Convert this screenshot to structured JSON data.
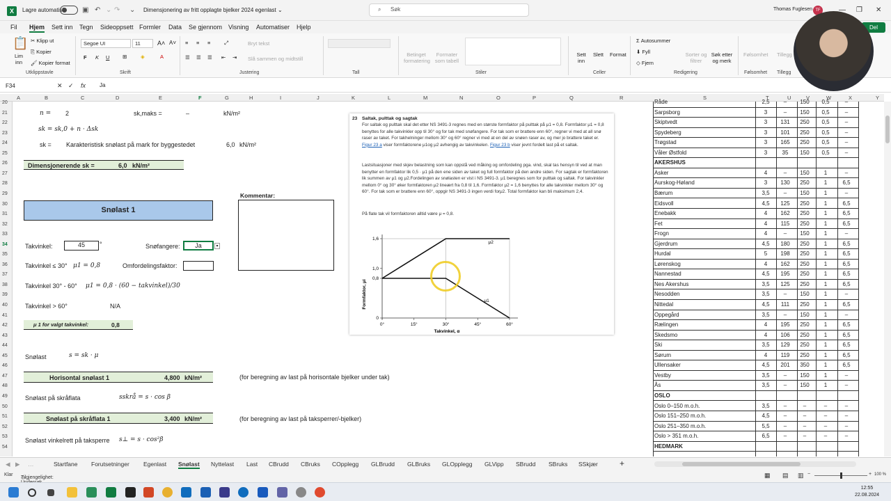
{
  "titlebar": {
    "autosave_label": "Lagre automatisk",
    "doc_title": "Dimensjonering av fritt opplagte bjelker 2024 egenlast ⌄",
    "search_placeholder": "Søk",
    "user_name": "Thomas Fuglesen",
    "user_initials": "TF"
  },
  "menu": [
    "Fil",
    "Hjem",
    "Sett inn",
    "Tegn",
    "Sideoppsett",
    "Formler",
    "Data",
    "Se gjennom",
    "Visning",
    "Automatiser",
    "Hjelp"
  ],
  "menu_active": "Hjem",
  "share_label": "Del",
  "ribbon": {
    "clipboard": {
      "paste": "Lim inn",
      "cut": "Klipp ut",
      "copy": "Kopier",
      "format_painter": "Kopier format",
      "group": "Utklippstavle"
    },
    "font": {
      "name": "Segoe UI",
      "size": "11",
      "group": "Skrift"
    },
    "alignment": {
      "wrap": "Bryt tekst",
      "merge": "Slå sammen og midtstill",
      "group": "Justering"
    },
    "number": {
      "group": "Tall"
    },
    "styles": {
      "conditional": "Betinget formatering",
      "format_table": "Formater som tabell",
      "group": "Stiler"
    },
    "cells": {
      "insert": "Sett inn",
      "delete": "Slett",
      "format": "Format",
      "group": "Celler"
    },
    "editing": {
      "autosum": "Autosummer",
      "fill": "Fyll",
      "clear": "Fjern",
      "sort": "Sorter og filtrer",
      "find": "Søk etter og merk",
      "group": "Redigering"
    },
    "sensitivity": {
      "label": "Følsomhet",
      "group": "Følsomhet"
    },
    "addins": {
      "label": "Tillegg",
      "group": "Tillegg"
    }
  },
  "formula_bar": {
    "cell_ref": "F34",
    "content": "Ja"
  },
  "columns": [
    "A",
    "B",
    "C",
    "D",
    "E",
    "F",
    "G",
    "H",
    "I",
    "J",
    "K",
    "L",
    "M",
    "N",
    "O",
    "P",
    "Q",
    "R",
    "S",
    "T",
    "U",
    "V",
    "W",
    "X",
    "Y"
  ],
  "rows": [
    "20",
    "21",
    "22",
    "23",
    "24",
    "25",
    "26",
    "27",
    "28",
    "29",
    "30",
    "31",
    "32",
    "33",
    "34",
    "35",
    "36",
    "37",
    "38",
    "39",
    "40",
    "41",
    "42",
    "43",
    "44",
    "45",
    "46",
    "47",
    "48",
    "49",
    "50",
    "51",
    "52",
    "53",
    "54"
  ],
  "sheet": {
    "n_label": "n  =",
    "n_value": "2",
    "skmaks_label": "sk,maks =",
    "skmaks_value": "–",
    "skmaks_unit": "kN/m²",
    "formula_sk": "sk = sk,0 + n · Δsk",
    "sk_label": "sk =",
    "sk_desc": "Karakteristisk snølast på mark for byggestedet",
    "sk_value": "6,0",
    "sk_unit": "kN/m²",
    "dim_label": "Dimensjonerende sk =",
    "dim_value": "6,0",
    "dim_unit": "kN/m²",
    "snowload_title": "Snølast 1",
    "comment_label": "Kommentar:",
    "roof_angle_label": "Takvinkel:",
    "roof_angle_value": "45",
    "degree": "°",
    "snow_guards_label": "Snøfangere:",
    "snow_guards_value": "Ja",
    "redistribution_label": "Omfordelingsfaktor:",
    "rule1_label": "Takvinkel ≤ 30°",
    "rule1_formula": "μ1 = 0,8",
    "rule2_label": "Takvinkel 30° - 60°",
    "rule2_formula": "μ1 = 0,8 · (60 − takvinkel)/30",
    "rule3_label": "Takvinkel > 60°",
    "rule3_value": "N/A",
    "mu_selected_label": "μ 1 for valgt takvinkel:",
    "mu_selected_value": "0,8",
    "snowload_label": "Snølast",
    "snowload_formula": "s = sk · μ",
    "horizontal_label": "Horisontal snølast 1",
    "horizontal_value": "4,800",
    "horizontal_unit": "kN/m²",
    "horizontal_note": "(for beregning av last på horisontale bjelker under tak)",
    "slope_label": "Snølast på skråflata",
    "slope_formula": "sskrå = s · cos β",
    "slope_result_label": "Snølast på skråflata 1",
    "slope_result_value": "3,400",
    "slope_result_unit": "kN/m²",
    "slope_note": "(for beregning av last på taksperrer/-bjelker)",
    "perp_label": "Snølast vinkelrett på taksperre",
    "perp_formula": "s⊥ = s · cos²β"
  },
  "doc": {
    "section_no": "23",
    "section_title": "Saltak, pulttak og sagtak",
    "para1": "For saltak og pulttak skal det etter NS 3491-3 regnes med en største formfaktor på pulttak på μ1 = 0,8. Formfaktor μ1 = 0,8 benyttes for alle takvinkler opp til 30° og for tak med snøfangere. For tak som er brattere enn 60°, regner vi med at all snø raser av taket. For takhelninger mellom 30° og 60° regner vi med at en del av snøen raser av, og mer jo brattere taket er. ",
    "para1_link": "Figur 23 a",
    "para1_end": " viser formfaktorene μ1og μ2 avhengig av takvinkelen. ",
    "para1_link2": "Figur 23 b",
    "para1_end2": " viser jevnt fordelt last på et saltak.",
    "para2": "Lastsituasjoner med skjev belastning som kan oppstå ved måking og omfordeling pga. vind, skal tas hensyn til ved at man benytter en formfaktor lik 0,5 · μ1 på den ene siden av taket og full formfaktor på den andre siden. For sagtak er formfaktoren lik summen av μ1 og μ2.Fordelingen av snølasten er vist i NS 3491-3. μ1 beregnes som for pulttak og saltak. For takvinkler mellom 0° og 30° øker formfaktoren μ2 lineært fra 0,8 til 1,6. Formfaktor μ2 = 1,6 benyttes for alle takvinkler mellom 30° og 60°. For tak som er brattere enn 60°, oppgir NS 3491-3 ingen verdi forμ2. Total formfaktor kan bli maksimum 2,4.",
    "para3": "På flate tak vil formfaktoren alltid være μ = 0,8.",
    "chart_ylabel": "Formfaktor, μi",
    "chart_xlabel": "Takvinkel, α",
    "mu1_label": "μ1",
    "mu2_label": "μ2"
  },
  "chart_data": {
    "type": "line",
    "xlabel": "Takvinkel, α",
    "ylabel": "Formfaktor, μi",
    "x_ticks": [
      "0°",
      "15°",
      "30°",
      "45°",
      "60°"
    ],
    "y_ticks": [
      "0",
      "0,8",
      "1,0",
      "1,6"
    ],
    "xlim": [
      0,
      60
    ],
    "ylim": [
      0,
      1.6
    ],
    "series": [
      {
        "name": "μ1",
        "x": [
          0,
          30,
          60
        ],
        "y": [
          0.8,
          0.8,
          0
        ]
      },
      {
        "name": "μ2",
        "x": [
          0,
          30,
          60
        ],
        "y": [
          0.8,
          1.6,
          1.6
        ]
      }
    ]
  },
  "region_table": [
    {
      "name": "Råde",
      "a": "2,5",
      "b": "–",
      "c": "150",
      "d": "0,5",
      "e": "–"
    },
    {
      "name": "Sarpsborg",
      "a": "3",
      "b": "–",
      "c": "150",
      "d": "0,5",
      "e": "–"
    },
    {
      "name": "Skiptvedt",
      "a": "3",
      "b": "131",
      "c": "250",
      "d": "0,5",
      "e": "–"
    },
    {
      "name": "Spydeberg",
      "a": "3",
      "b": "101",
      "c": "250",
      "d": "0,5",
      "e": "–"
    },
    {
      "name": "Trøgstad",
      "a": "3",
      "b": "165",
      "c": "250",
      "d": "0,5",
      "e": "–"
    },
    {
      "name": "Våler Østfold",
      "a": "3",
      "b": "35",
      "c": "150",
      "d": "0,5",
      "e": "–"
    },
    {
      "name": "AKERSHUS",
      "heading": true
    },
    {
      "name": "Asker",
      "a": "4",
      "b": "–",
      "c": "150",
      "d": "1",
      "e": "–"
    },
    {
      "name": "Aurskog-Høland",
      "a": "3",
      "b": "130",
      "c": "250",
      "d": "1",
      "e": "6,5"
    },
    {
      "name": "Bærum",
      "a": "3,5",
      "b": "–",
      "c": "150",
      "d": "1",
      "e": "–"
    },
    {
      "name": "Eidsvoll",
      "a": "4,5",
      "b": "125",
      "c": "250",
      "d": "1",
      "e": "6,5"
    },
    {
      "name": "Enebakk",
      "a": "4",
      "b": "162",
      "c": "250",
      "d": "1",
      "e": "6,5"
    },
    {
      "name": "Fet",
      "a": "4",
      "b": "115",
      "c": "250",
      "d": "1",
      "e": "6,5"
    },
    {
      "name": "Frogn",
      "a": "4",
      "b": "–",
      "c": "150",
      "d": "1",
      "e": "–"
    },
    {
      "name": "Gjerdrum",
      "a": "4,5",
      "b": "180",
      "c": "250",
      "d": "1",
      "e": "6,5"
    },
    {
      "name": "Hurdal",
      "a": "5",
      "b": "198",
      "c": "250",
      "d": "1",
      "e": "6,5"
    },
    {
      "name": "Lørenskog",
      "a": "4",
      "b": "162",
      "c": "250",
      "d": "1",
      "e": "6,5"
    },
    {
      "name": "Nannestad",
      "a": "4,5",
      "b": "195",
      "c": "250",
      "d": "1",
      "e": "6,5"
    },
    {
      "name": "Nes Akershus",
      "a": "3,5",
      "b": "125",
      "c": "250",
      "d": "1",
      "e": "6,5"
    },
    {
      "name": "Nesodden",
      "a": "3,5",
      "b": "–",
      "c": "150",
      "d": "1",
      "e": "–"
    },
    {
      "name": "Nittedal",
      "a": "4,5",
      "b": "111",
      "c": "250",
      "d": "1",
      "e": "6,5"
    },
    {
      "name": "Oppegård",
      "a": "3,5",
      "b": "–",
      "c": "150",
      "d": "1",
      "e": "–"
    },
    {
      "name": "Rælingen",
      "a": "4",
      "b": "195",
      "c": "250",
      "d": "1",
      "e": "6,5"
    },
    {
      "name": "Skedsmo",
      "a": "4",
      "b": "106",
      "c": "250",
      "d": "1",
      "e": "6,5"
    },
    {
      "name": "Ski",
      "a": "3,5",
      "b": "129",
      "c": "250",
      "d": "1",
      "e": "6,5"
    },
    {
      "name": "Sørum",
      "a": "4",
      "b": "119",
      "c": "250",
      "d": "1",
      "e": "6,5"
    },
    {
      "name": "Ullensaker",
      "a": "4,5",
      "b": "201",
      "c": "350",
      "d": "1",
      "e": "6,5"
    },
    {
      "name": "Vestby",
      "a": "3,5",
      "b": "–",
      "c": "150",
      "d": "1",
      "e": "–"
    },
    {
      "name": "Ås",
      "a": "3,5",
      "b": "–",
      "c": "150",
      "d": "1",
      "e": "–"
    },
    {
      "name": "OSLO",
      "heading": true
    },
    {
      "name": "Oslo 0–150 m.o.h.",
      "a": "3,5",
      "b": "–",
      "c": "–",
      "d": "–",
      "e": "–"
    },
    {
      "name": "Oslo 151–250 m.o.h.",
      "a": "4,5",
      "b": "–",
      "c": "–",
      "d": "–",
      "e": "–"
    },
    {
      "name": "Oslo 251–350 m.o.h.",
      "a": "5,5",
      "b": "–",
      "c": "–",
      "d": "–",
      "e": "–"
    },
    {
      "name": "Oslo > 351 m.o.h.",
      "a": "6,5",
      "b": "–",
      "c": "–",
      "d": "–",
      "e": "–"
    },
    {
      "name": "HEDMARK",
      "heading": true
    }
  ],
  "sheet_tabs": [
    "Startfane",
    "Forutsetninger",
    "Egenlast",
    "Snølast",
    "Nyttelast",
    "Last",
    "CBrudd",
    "CBruks",
    "COpplegg",
    "GLBrudd",
    "GLBruks",
    "GLOpplegg",
    "GLVipp",
    "SBrudd",
    "SBruks",
    "SSkjær"
  ],
  "sheet_tab_active": "Snølast",
  "status": {
    "ready": "Klar",
    "accessibility": "Tilgjengelighet: Undersøk",
    "zoom": "100 %"
  },
  "clock": {
    "time": "12:55",
    "date": "22.08.2024"
  },
  "colors": {
    "excel_green": "#107c41",
    "title_box": "#a9c8ea",
    "result_bar": "#e2efd9"
  }
}
